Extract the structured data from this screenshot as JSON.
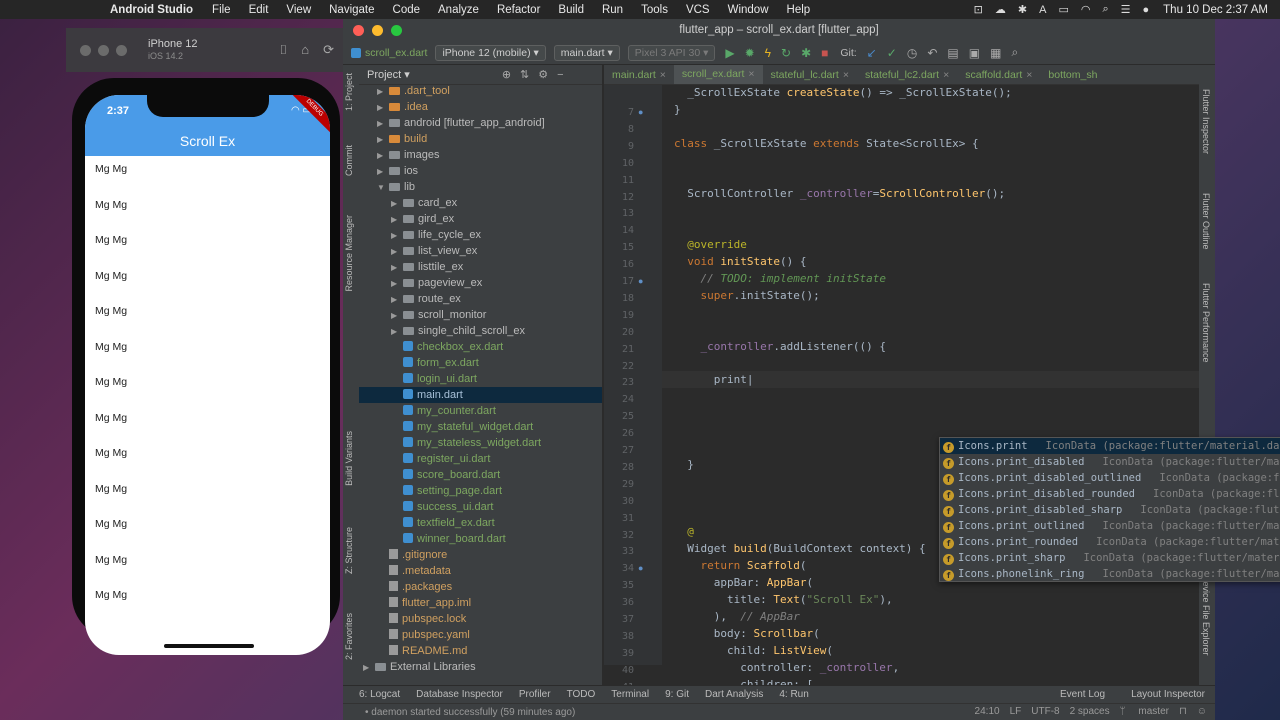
{
  "menubar": {
    "app_name": "Android Studio",
    "items": [
      "File",
      "Edit",
      "View",
      "Navigate",
      "Code",
      "Analyze",
      "Refactor",
      "Build",
      "Run",
      "Tools",
      "VCS",
      "Window",
      "Help"
    ],
    "clock": "Thu 10 Dec  2:37 AM"
  },
  "simulator": {
    "device": "iPhone 12",
    "os": "iOS 14.2",
    "status_time": "2:37",
    "app_title": "Scroll Ex",
    "debug_label": "DEBUG",
    "list_item_text": "Mg Mg",
    "list_count": 13
  },
  "ide": {
    "window_title": "flutter_app – scroll_ex.dart [flutter_app]",
    "toolbar": {
      "breadcrumb_file": "scroll_ex.dart",
      "device_combo": "iPhone 12 (mobile)",
      "run_config": "main.dart",
      "emulator": "Pixel 3 API 30",
      "git_label": "Git:"
    },
    "left_tabs": [
      "1: Project",
      "Commit",
      "Resource Manager",
      "Build Variants",
      "Z: Structure",
      "2: Favorites"
    ],
    "right_tabs": [
      "Flutter Inspector",
      "Flutter Outline",
      "Flutter Performance",
      "Emulator",
      "Device File Explorer"
    ],
    "project": {
      "header": "Project",
      "tree": [
        {
          "label": ".dart_tool",
          "kind": "folder-orange",
          "indent": 1,
          "arrow": "▶",
          "color": "#d0a060"
        },
        {
          "label": ".idea",
          "kind": "folder-orange",
          "indent": 1,
          "arrow": "▶",
          "color": "#d0a060"
        },
        {
          "label": "android [flutter_app_android]",
          "kind": "folder",
          "indent": 1,
          "arrow": "▶",
          "color": "#bbbbbb"
        },
        {
          "label": "build",
          "kind": "folder-orange",
          "indent": 1,
          "arrow": "▶",
          "color": "#d0a060"
        },
        {
          "label": "images",
          "kind": "folder",
          "indent": 1,
          "arrow": "▶",
          "color": "#bbbbbb"
        },
        {
          "label": "ios",
          "kind": "folder",
          "indent": 1,
          "arrow": "▶",
          "color": "#bbbbbb"
        },
        {
          "label": "lib",
          "kind": "folder",
          "indent": 1,
          "arrow": "▼",
          "color": "#bbbbbb"
        },
        {
          "label": "card_ex",
          "kind": "folder",
          "indent": 2,
          "arrow": "▶",
          "color": "#bbbbbb"
        },
        {
          "label": "gird_ex",
          "kind": "folder",
          "indent": 2,
          "arrow": "▶",
          "color": "#bbbbbb"
        },
        {
          "label": "life_cycle_ex",
          "kind": "folder",
          "indent": 2,
          "arrow": "▶",
          "color": "#bbbbbb"
        },
        {
          "label": "list_view_ex",
          "kind": "folder",
          "indent": 2,
          "arrow": "▶",
          "color": "#bbbbbb"
        },
        {
          "label": "listtile_ex",
          "kind": "folder",
          "indent": 2,
          "arrow": "▶",
          "color": "#bbbbbb"
        },
        {
          "label": "pageview_ex",
          "kind": "folder",
          "indent": 2,
          "arrow": "▶",
          "color": "#bbbbbb"
        },
        {
          "label": "route_ex",
          "kind": "folder",
          "indent": 2,
          "arrow": "▶",
          "color": "#bbbbbb"
        },
        {
          "label": "scroll_monitor",
          "kind": "folder",
          "indent": 2,
          "arrow": "▶",
          "color": "#bbbbbb"
        },
        {
          "label": "single_child_scroll_ex",
          "kind": "folder",
          "indent": 2,
          "arrow": "▶",
          "color": "#bbbbbb"
        },
        {
          "label": "checkbox_ex.dart",
          "kind": "dart",
          "indent": 2,
          "arrow": "",
          "color": "#7da760"
        },
        {
          "label": "form_ex.dart",
          "kind": "dart",
          "indent": 2,
          "arrow": "",
          "color": "#7da760"
        },
        {
          "label": "login_ui.dart",
          "kind": "dart",
          "indent": 2,
          "arrow": "",
          "color": "#7da760"
        },
        {
          "label": "main.dart",
          "kind": "dart",
          "indent": 2,
          "arrow": "",
          "color": "#a7c0d8",
          "selected": true
        },
        {
          "label": "my_counter.dart",
          "kind": "dart",
          "indent": 2,
          "arrow": "",
          "color": "#7da760"
        },
        {
          "label": "my_stateful_widget.dart",
          "kind": "dart",
          "indent": 2,
          "arrow": "",
          "color": "#7da760"
        },
        {
          "label": "my_stateless_widget.dart",
          "kind": "dart",
          "indent": 2,
          "arrow": "",
          "color": "#7da760"
        },
        {
          "label": "register_ui.dart",
          "kind": "dart",
          "indent": 2,
          "arrow": "",
          "color": "#7da760"
        },
        {
          "label": "score_board.dart",
          "kind": "dart",
          "indent": 2,
          "arrow": "",
          "color": "#7da760"
        },
        {
          "label": "setting_page.dart",
          "kind": "dart",
          "indent": 2,
          "arrow": "",
          "color": "#7da760"
        },
        {
          "label": "success_ui.dart",
          "kind": "dart",
          "indent": 2,
          "arrow": "",
          "color": "#7da760"
        },
        {
          "label": "textfield_ex.dart",
          "kind": "dart",
          "indent": 2,
          "arrow": "",
          "color": "#7da760"
        },
        {
          "label": "winner_board.dart",
          "kind": "dart",
          "indent": 2,
          "arrow": "",
          "color": "#7da760"
        },
        {
          "label": ".gitignore",
          "kind": "gen",
          "indent": 1,
          "arrow": "",
          "color": "#d0a060"
        },
        {
          "label": ".metadata",
          "kind": "gen",
          "indent": 1,
          "arrow": "",
          "color": "#d0a060"
        },
        {
          "label": ".packages",
          "kind": "gen",
          "indent": 1,
          "arrow": "",
          "color": "#d0a060"
        },
        {
          "label": "flutter_app.iml",
          "kind": "gen",
          "indent": 1,
          "arrow": "",
          "color": "#d0a060"
        },
        {
          "label": "pubspec.lock",
          "kind": "gen",
          "indent": 1,
          "arrow": "",
          "color": "#d0a060"
        },
        {
          "label": "pubspec.yaml",
          "kind": "gen",
          "indent": 1,
          "arrow": "",
          "color": "#d0a060"
        },
        {
          "label": "README.md",
          "kind": "gen",
          "indent": 1,
          "arrow": "",
          "color": "#d0a060"
        },
        {
          "label": "External Libraries",
          "kind": "folder",
          "indent": 0,
          "arrow": "▶",
          "color": "#bbbbbb"
        }
      ]
    },
    "tabs": [
      {
        "label": "main.dart",
        "active": false
      },
      {
        "label": "scroll_ex.dart",
        "active": true
      },
      {
        "label": "stateful_lc.dart",
        "active": false
      },
      {
        "label": "stateful_lc2.dart",
        "active": false
      },
      {
        "label": "scaffold.dart",
        "active": false
      },
      {
        "label": "bottom_sh",
        "active": false
      }
    ],
    "code_lines": [
      {
        "n": "7",
        "html": "  <span class=\"cls\">_ScrollExState</span> <span class=\"fn\">createState</span>() => <span class=\"cls\">_ScrollExState</span>();"
      },
      {
        "n": "8",
        "html": "}"
      },
      {
        "n": "9",
        "html": ""
      },
      {
        "n": "10",
        "html": "<span class=\"kw\">class</span> _ScrollExState <span class=\"kw\">extends</span> State&lt;ScrollEx&gt; {"
      },
      {
        "n": "11",
        "html": ""
      },
      {
        "n": "12",
        "html": ""
      },
      {
        "n": "13",
        "html": "  ScrollController <span class=\"fd\">_controller</span>=<span class=\"fn\">ScrollController</span>();"
      },
      {
        "n": "14",
        "html": ""
      },
      {
        "n": "15",
        "html": ""
      },
      {
        "n": "16",
        "html": "  <span class=\"an\">@override</span>"
      },
      {
        "n": "17",
        "html": "  <span class=\"kw\">void</span> <span class=\"fn\">initState</span>() {"
      },
      {
        "n": "18",
        "html": "    <span class=\"cmt\">// </span><span class=\"cm\">TODO: implement initState</span>"
      },
      {
        "n": "19",
        "html": "    <span class=\"kw\">super</span>.initState();"
      },
      {
        "n": "20",
        "html": ""
      },
      {
        "n": "21",
        "html": ""
      },
      {
        "n": "22",
        "html": "    <span class=\"fd\">_controller</span>.addListener(() {"
      },
      {
        "n": "23",
        "html": ""
      },
      {
        "n": "24",
        "html": "      print|"
      },
      {
        "n": "25",
        "html": ""
      },
      {
        "n": "26",
        "html": ""
      },
      {
        "n": "27",
        "html": ""
      },
      {
        "n": "28",
        "html": ""
      },
      {
        "n": "29",
        "html": "  }"
      },
      {
        "n": "30",
        "html": ""
      },
      {
        "n": "31",
        "html": ""
      },
      {
        "n": "32",
        "html": ""
      },
      {
        "n": "33",
        "html": "  <span class=\"an\">@</span>"
      },
      {
        "n": "34",
        "html": "  Widget <span class=\"fn\">build</span>(BuildContext context) {"
      },
      {
        "n": "35",
        "html": "    <span class=\"kw\">return</span> <span class=\"fn\">Scaffold</span>("
      },
      {
        "n": "36",
        "html": "      appBar: <span class=\"fn\">AppBar</span>("
      },
      {
        "n": "37",
        "html": "        title: <span class=\"fn\">Text</span>(<span class=\"st\">\"Scroll Ex\"</span>),"
      },
      {
        "n": "38",
        "html": "      ),  <span class=\"cmt\">// AppBar</span>"
      },
      {
        "n": "39",
        "html": "      body: <span class=\"fn\">Scrollbar</span>("
      },
      {
        "n": "40",
        "html": "        child: <span class=\"fn\">ListView</span>("
      },
      {
        "n": "41",
        "html": "          controller: <span class=\"fd\">_controller</span>,"
      },
      {
        "n": "42",
        "html": "          children: ["
      }
    ],
    "completion": [
      {
        "name": "Icons.print",
        "type": "IconData (package:flutter/material.dart)"
      },
      {
        "name": "Icons.print_disabled",
        "type": "IconData (package:flutter/materi…"
      },
      {
        "name": "Icons.print_disabled_outlined",
        "type": "IconData (package:flutt…"
      },
      {
        "name": "Icons.print_disabled_rounded",
        "type": "IconData (package:flutte…"
      },
      {
        "name": "Icons.print_disabled_sharp",
        "type": "IconData (package:flutter/…"
      },
      {
        "name": "Icons.print_outlined",
        "type": "IconData (package:flutter/materi…"
      },
      {
        "name": "Icons.print_rounded",
        "type": "IconData (package:flutter/materia…"
      },
      {
        "name": "Icons.print_sharp",
        "type": "IconData (package:flutter/material…"
      },
      {
        "name": "Icons.phonelink_ring",
        "type": "IconData (package:flutter/materi…"
      }
    ],
    "bottom_tabs": [
      "6: Logcat",
      "Database Inspector",
      "Profiler",
      "TODO",
      "Terminal",
      "9: Git",
      "Dart Analysis",
      "4: Run"
    ],
    "bottom_right": [
      "Event Log",
      "Layout Inspector"
    ],
    "status": {
      "message": "• daemon started successfully (59 minutes ago)",
      "position": "24:10",
      "line_sep": "LF",
      "encoding": "UTF-8",
      "indent": "2 spaces",
      "branch": "master"
    }
  }
}
